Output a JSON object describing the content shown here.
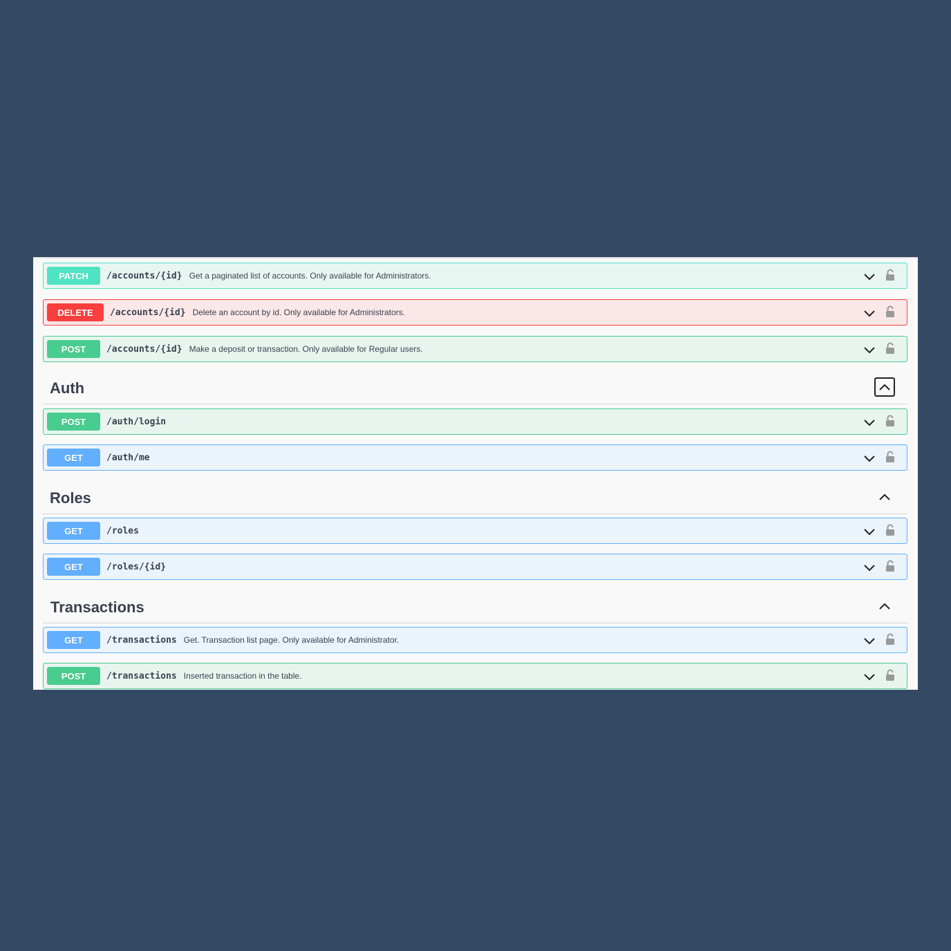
{
  "colors": {
    "background": "#344a64",
    "patch": "#50e3c2",
    "delete": "#f93e3e",
    "post": "#49cc90",
    "get": "#61affe"
  },
  "accounts_ops": [
    {
      "method": "PATCH",
      "path": "/accounts/{id}",
      "description": "Get a paginated list of accounts. Only available for Administrators."
    },
    {
      "method": "DELETE",
      "path": "/accounts/{id}",
      "description": "Delete an account by id. Only available for Administrators."
    },
    {
      "method": "POST",
      "path": "/accounts/{id}",
      "description": "Make a deposit or transaction. Only available for Regular users."
    }
  ],
  "auth": {
    "title": "Auth",
    "ops": [
      {
        "method": "POST",
        "path": "/auth/login",
        "description": ""
      },
      {
        "method": "GET",
        "path": "/auth/me",
        "description": ""
      }
    ]
  },
  "roles": {
    "title": "Roles",
    "ops": [
      {
        "method": "GET",
        "path": "/roles",
        "description": ""
      },
      {
        "method": "GET",
        "path": "/roles/{id}",
        "description": ""
      }
    ]
  },
  "transactions": {
    "title": "Transactions",
    "ops": [
      {
        "method": "GET",
        "path": "/transactions",
        "description": "Get. Transaction list page. Only available for Administrator."
      },
      {
        "method": "POST",
        "path": "/transactions",
        "description": "Inserted transaction in the table."
      }
    ]
  },
  "icons": {
    "expand": "chevron-down-icon",
    "collapse": "chevron-up-icon",
    "auth": "lock-icon"
  }
}
